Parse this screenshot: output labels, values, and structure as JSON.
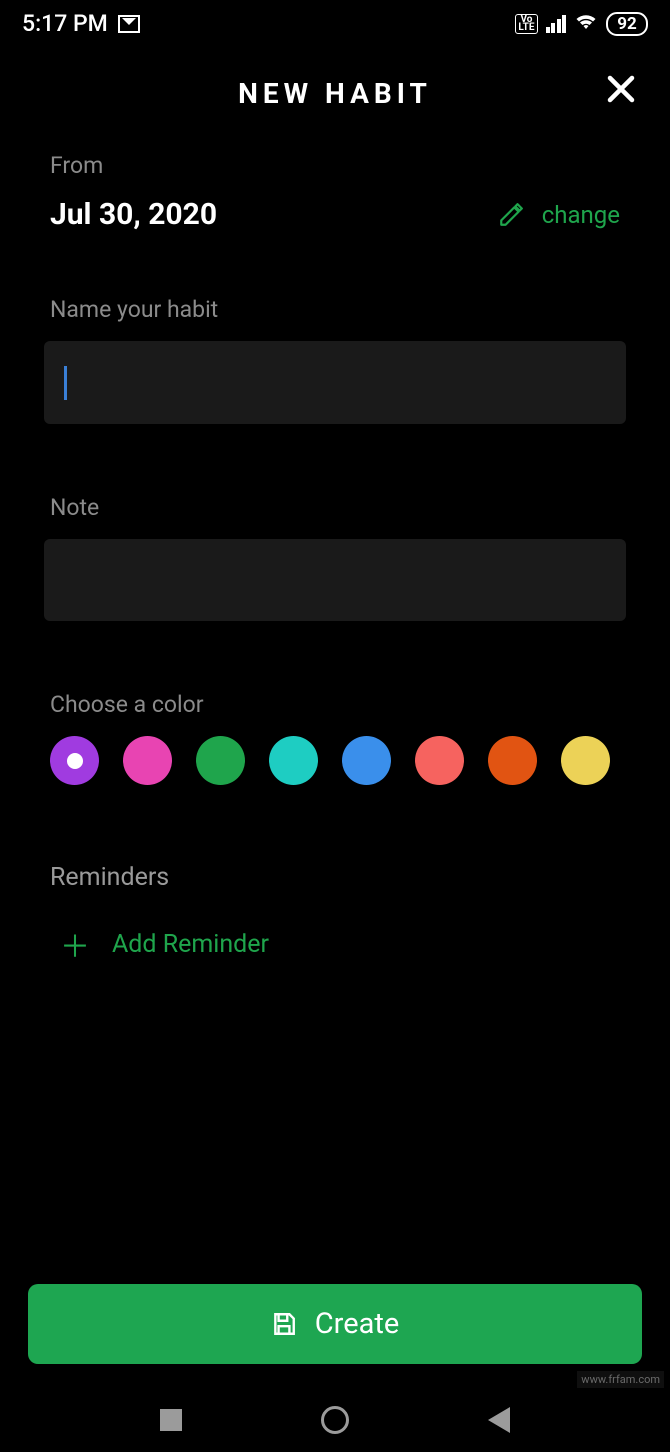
{
  "status": {
    "time": "5:17 PM",
    "battery": "92",
    "volte": "Vo\nLTE"
  },
  "header": {
    "title": "NEW HABIT"
  },
  "from": {
    "label": "From",
    "date": "Jul 30, 2020",
    "change": "change"
  },
  "name": {
    "label": "Name your habit",
    "value": ""
  },
  "note": {
    "label": "Note",
    "value": ""
  },
  "color": {
    "label": "Choose a color",
    "options": [
      "#a03be0",
      "#e844b2",
      "#1fa54c",
      "#1ecdc2",
      "#3a8feb",
      "#f6635f",
      "#e15412",
      "#ecd257"
    ],
    "selected_index": 0
  },
  "reminders": {
    "label": "Reminders",
    "add": "Add Reminder"
  },
  "create": {
    "label": "Create"
  },
  "watermark": "www.frfam.com"
}
